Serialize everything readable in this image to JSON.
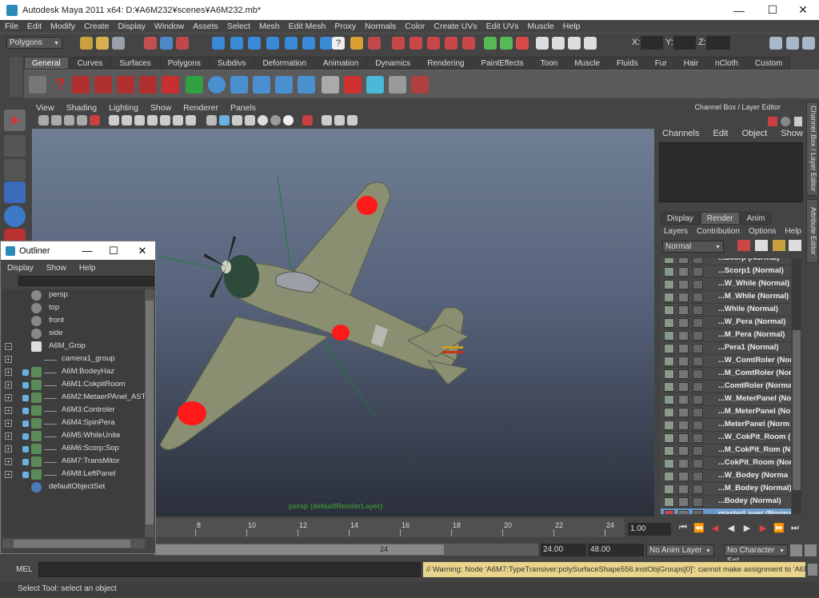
{
  "window": {
    "title": "Autodesk Maya 2011 x64: D:¥A6M232¥scenes¥A6M232.mb*",
    "minimize": "—",
    "maximize": "☐",
    "close": "✕"
  },
  "menubar": [
    "File",
    "Edit",
    "Modify",
    "Create",
    "Display",
    "Window",
    "Assets",
    "Select",
    "Mesh",
    "Edit Mesh",
    "Proxy",
    "Normals",
    "Color",
    "Create UVs",
    "Edit UVs",
    "Muscle",
    "Help"
  ],
  "statusline": {
    "mode": "Polygons",
    "x_label": "X:",
    "y_label": "Y:",
    "z_label": "Z:"
  },
  "shelf": {
    "tabs": [
      "General",
      "Curves",
      "Surfaces",
      "Polygons",
      "Subdivs",
      "Deformation",
      "Animation",
      "Dynamics",
      "Rendering",
      "PaintEffects",
      "Toon",
      "Muscle",
      "Fluids",
      "Fur",
      "Hair",
      "nCloth",
      "Custom"
    ],
    "active": "General"
  },
  "panel": {
    "menu": [
      "View",
      "Shading",
      "Lighting",
      "Show",
      "Renderer",
      "Panels"
    ],
    "camera_label": "persp (defaultRenderLayer)"
  },
  "channelbox": {
    "header": "Channel Box / Layer Editor",
    "menu": [
      "Channels",
      "Edit",
      "Object",
      "Show"
    ],
    "layer_tabs": [
      "Display",
      "Render",
      "Anim"
    ],
    "active_layer_tab": "Render",
    "layer_menu": [
      "Layers",
      "Contribution",
      "Options",
      "Help"
    ],
    "blend_mode": "Normal",
    "layers": [
      "...Scorp (Normal)",
      "...Scorp1 (Normal)",
      "...W_While (Normal)",
      "...M_While (Normal)",
      "...While (Normal)",
      "...W_Pera (Normal)",
      "...M_Pera (Normal)",
      "...Pera1 (Normal)",
      "...W_ComtRoler (Nor",
      "...M_ComtRoler (Nor",
      "...ComtRoler (Norma",
      "...W_MeterPanel (No",
      "...M_MeterPanel (No",
      "...MeterPanel (Norm",
      "...W_CokPit_Room (",
      "...M_CokPit_Rom (N",
      "...CokPit_Room (Nor",
      "...W_Bodey (Norma",
      "...M_Bodey (Normal)",
      "...Bodey (Normal)",
      "masterLayer (Norma"
    ],
    "selected_layer": "masterLayer (Norma",
    "side_tabs": [
      "Channel Box / Layer Editor",
      "Attribute Editor"
    ]
  },
  "outliner": {
    "title": "Outliner",
    "menu": [
      "Display",
      "Show",
      "Help"
    ],
    "items": [
      {
        "label": "persp",
        "indent": 0,
        "expand": "",
        "icon": "camera-icon"
      },
      {
        "label": "top",
        "indent": 0,
        "expand": "",
        "icon": "camera-icon"
      },
      {
        "label": "front",
        "indent": 0,
        "expand": "",
        "icon": "camera-icon"
      },
      {
        "label": "side",
        "indent": 0,
        "expand": "",
        "icon": "camera-icon"
      },
      {
        "label": "A6M_Grop",
        "indent": 0,
        "expand": "−",
        "icon": "group-icon"
      },
      {
        "label": "camera1_group",
        "indent": 1,
        "expand": "+",
        "icon": "none"
      },
      {
        "label": "A6M:BodeyHaz",
        "indent": 1,
        "expand": "+",
        "icon": "mesh-icon"
      },
      {
        "label": "A6M1:CokpitRoom",
        "indent": 1,
        "expand": "+",
        "icon": "mesh-icon"
      },
      {
        "label": "A6M2:MetaerPAnel_AST",
        "indent": 1,
        "expand": "+",
        "icon": "mesh-icon"
      },
      {
        "label": "A6M3:Controler",
        "indent": 1,
        "expand": "+",
        "icon": "mesh-icon"
      },
      {
        "label": "A6M4:SpinPera",
        "indent": 1,
        "expand": "+",
        "icon": "mesh-icon"
      },
      {
        "label": "A6M5:WhileUnite",
        "indent": 1,
        "expand": "+",
        "icon": "mesh-icon"
      },
      {
        "label": "A6M6:Scorp:Sop",
        "indent": 1,
        "expand": "+",
        "icon": "mesh-icon"
      },
      {
        "label": "A6M7:TransMitor",
        "indent": 1,
        "expand": "+",
        "icon": "mesh-icon"
      },
      {
        "label": "A6M8:LeftPanel",
        "indent": 1,
        "expand": "+",
        "icon": "mesh-icon"
      },
      {
        "label": "defaultObjectSet",
        "indent": 0,
        "expand": "",
        "icon": "set-icon"
      }
    ]
  },
  "timeline": {
    "ticks": [
      "8",
      "10",
      "12",
      "14",
      "16",
      "18",
      "20",
      "22",
      "24"
    ],
    "current_frame": "1.00",
    "range_end_field": "24",
    "start": "24.00",
    "end": "48.00",
    "anim_layer": "No Anim Layer",
    "character_set": "No Character Set"
  },
  "commandline": {
    "label": "MEL",
    "feedback": "// Warning: Node 'A6M7:TypeTransiver:polySurfaceShape556.instObjGroups[0]': cannot make assignment to 'A6M7:TypeTra"
  },
  "helpline": "Select Tool: select an object",
  "colors": {
    "accent_blue": "#6a98c8",
    "hinomaru_red": "#ff1a1a",
    "plane_body": "#8a8f72"
  }
}
